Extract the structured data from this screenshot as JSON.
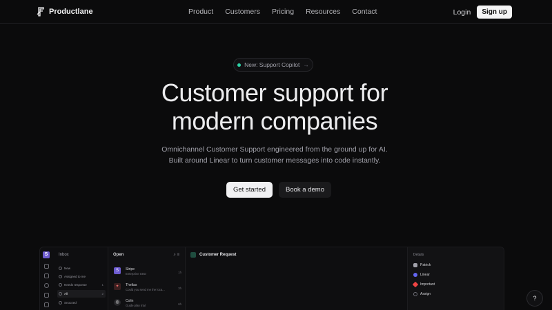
{
  "nav": {
    "brand": "Productlane",
    "links": [
      "Product",
      "Customers",
      "Pricing",
      "Resources",
      "Contact"
    ],
    "login": "Login",
    "signup": "Sign up"
  },
  "hero": {
    "badge": "New: Support Copilot",
    "badge_arrow": "→",
    "headline_line1": "Customer support for",
    "headline_line2": "modern companies",
    "sub_line1": "Omnichannel Customer Support engineered from the ground up for AI.",
    "sub_line2": "Built around Linear to turn customer messages into code instantly.",
    "cta_primary": "Get started",
    "cta_secondary": "Book a demo"
  },
  "preview": {
    "rail_logo": "S",
    "inbox_title": "Inbox",
    "inbox_items": [
      {
        "label": "New",
        "count": ""
      },
      {
        "label": "Assigned to me",
        "count": ""
      },
      {
        "label": "Needs response",
        "count": "1"
      },
      {
        "label": "All",
        "count": "2"
      },
      {
        "label": "Snoozed",
        "count": ""
      }
    ],
    "open_title": "Open",
    "open_tools": "⌕ ≡",
    "conversations": [
      {
        "avatar": "S",
        "name": "Stripe",
        "msg": "Enterprise SSO",
        "time": "1h",
        "color": "#6d5bd0"
      },
      {
        "avatar": "✦",
        "name": "Theltas",
        "msg": "Could you send me the loca...",
        "time": "3h",
        "color": "#3a1f1f"
      },
      {
        "avatar": "◎",
        "name": "Colin",
        "msg": "Guide plan trial",
        "time": "6h",
        "color": "#27272a"
      }
    ],
    "main_title": "Customer Request",
    "details_title": "Details",
    "details": [
      {
        "label": "Patrick",
        "color": "#a1a1aa"
      },
      {
        "label": "Linear",
        "color": "#6366f1"
      },
      {
        "label": "Important",
        "color": "#ef4444"
      },
      {
        "label": "Assign",
        "color": "#71717a"
      }
    ]
  },
  "help": "?"
}
